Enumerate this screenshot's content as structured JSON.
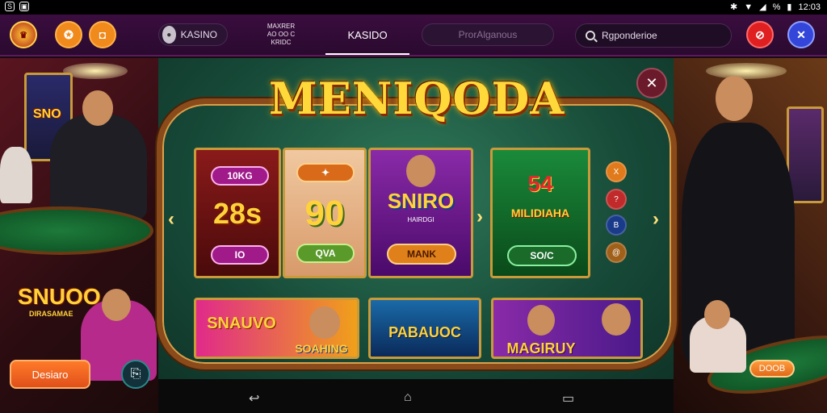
{
  "statusbar": {
    "time": "12:03",
    "left_icons": [
      "app-icon",
      "sim-icon"
    ],
    "right_icons": [
      "bluetooth-icon",
      "wifi-icon",
      "signal-icon",
      "battery-icon"
    ],
    "battery_text": "%"
  },
  "topbar": {
    "tab_kasino": "KASINO",
    "tab_small": "MAXRER\nAO OO C\nKRIDC",
    "tab_active": "KASIDO",
    "tab_dim": "ProrAlganous",
    "search_placeholder": "Rgponderioe"
  },
  "left_scene": {
    "sign": "SNUOO",
    "sign_sub": "DIRASAMAE",
    "poster": "SNO",
    "button": "Desiaro"
  },
  "right_scene": {
    "badge": "DOOB"
  },
  "center": {
    "title": "MENIQODA",
    "card1": {
      "top": "10KG",
      "big": "28s",
      "bottom": "IO"
    },
    "card2": {
      "big": "90",
      "bottom": "QVA"
    },
    "card3": {
      "big": "SNIRO",
      "sub": "HAIRDGI",
      "bottom": "MANK"
    },
    "card4": {
      "big": "54",
      "sub": "MILIDIAHA",
      "bottom": "SO/C"
    },
    "card5": {
      "big": "SNAUVO",
      "sub": "SOAHING"
    },
    "card6": {
      "big": "PABAUOC"
    },
    "card7": {
      "big": "MAGIRUY"
    },
    "dots": [
      "X",
      "?",
      "B",
      "@"
    ]
  },
  "colors": {
    "gold": "#ffd83a",
    "frame": "#8a4a1a",
    "felt": "#174a38",
    "topbar": "#2a0a2f"
  }
}
